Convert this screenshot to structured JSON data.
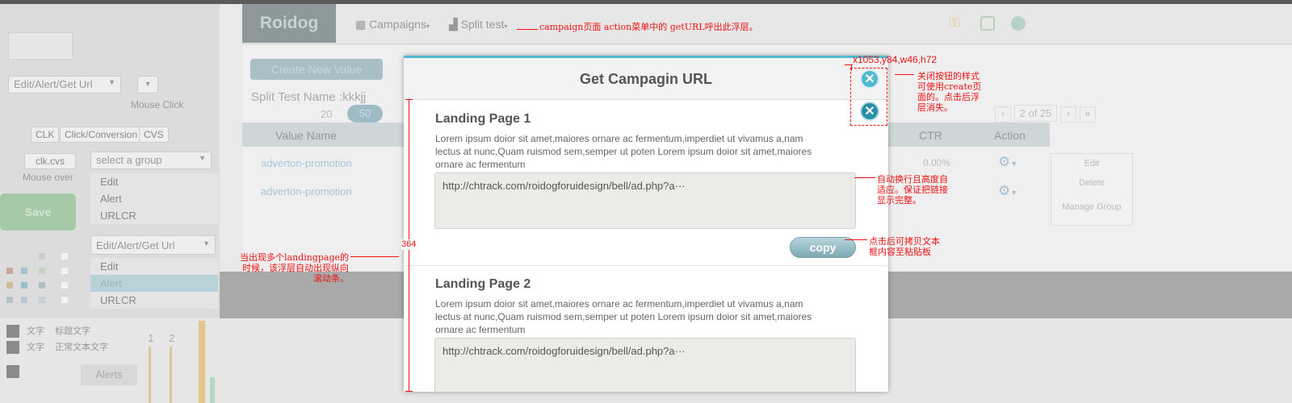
{
  "header": {
    "logo": "Roidog",
    "nav": [
      "Campaigns",
      "Split test"
    ]
  },
  "left_panel": {
    "select1": "Edit/Alert/Get Url",
    "mouse_click": "Mouse Click",
    "chips": [
      "CLK",
      "Click/Conversion",
      "CVS"
    ],
    "select_group_placeholder": "select a group",
    "chip_left": "clk.cvs",
    "mouse_over": "Mouse over",
    "menu1": [
      "Edit",
      "Alert",
      "URLCR"
    ],
    "save": "Save",
    "select2": "Edit/Alert/Get Url",
    "menu2": [
      "Edit",
      "Alert",
      "URLCR"
    ],
    "legend": [
      {
        "a": "文字",
        "b": "标题文字"
      },
      {
        "a": "文字",
        "b": "正常文本文字"
      }
    ],
    "nums": [
      "1",
      "2"
    ],
    "alerts_tab": "Alerts"
  },
  "content": {
    "create_button": "Create New Value",
    "split_test_name": "Split Test Name :kkkjj",
    "page_sizes": [
      "20",
      "50"
    ],
    "columns": [
      "Value Name",
      "CTR",
      "Action"
    ],
    "rows": [
      {
        "name": "adverton-promotion",
        "ctr": "0.00%"
      },
      {
        "name": "adverton-promotion",
        "ctr": ""
      }
    ],
    "pagination": "2 of 25",
    "action_menu": [
      "Edit",
      "Delete",
      "Manage Group"
    ]
  },
  "modal": {
    "title": "Get Campagin URL",
    "pages": [
      {
        "title": "Landing Page 1",
        "desc": "Lorem ipsum doior sit amet,maiores ornare ac fermentum,imperdiet ut vivamus a,nam lectus at nunc,Quam ruismod sem,semper ut poten Lorem ipsum doior sit amet,maiores ornare ac fermentum",
        "url": "http://chtrack.com/roidogforuidesign/bell/ad.php?a···"
      },
      {
        "title": "Landing Page 2",
        "desc": "Lorem ipsum doior sit amet,maiores ornare ac fermentum,imperdiet ut vivamus a,nam lectus at nunc,Quam ruismod sem,semper ut poten Lorem ipsum doior sit amet,maiores ornare ac fermentum",
        "url": "http://chtrack.com/roidogforuidesign/bell/ad.php?a···"
      }
    ],
    "copy_label": "copy"
  },
  "annotations": {
    "top": "campaign页面 action菜单中的 getURL呼出此浮层。",
    "coords": "x1053,y84,w46,h72",
    "close_note": "关闭按钮的样式可使用create页面的。点击后浮层消失。",
    "wrap_note": "自动换行且高度自适应。保证把链接显示完整。",
    "copy_note": "点击后可拷贝文本框内容至粘贴板",
    "scroll_note": "当出现多个landingpage的时候，该浮层自动出现纵向滚动条。",
    "height": "364"
  },
  "colors": {
    "accent": "#4fb9cd",
    "close_active": "#4fb9cd",
    "close_pressed": "#2a8ea8",
    "annotation": "#e11111"
  }
}
